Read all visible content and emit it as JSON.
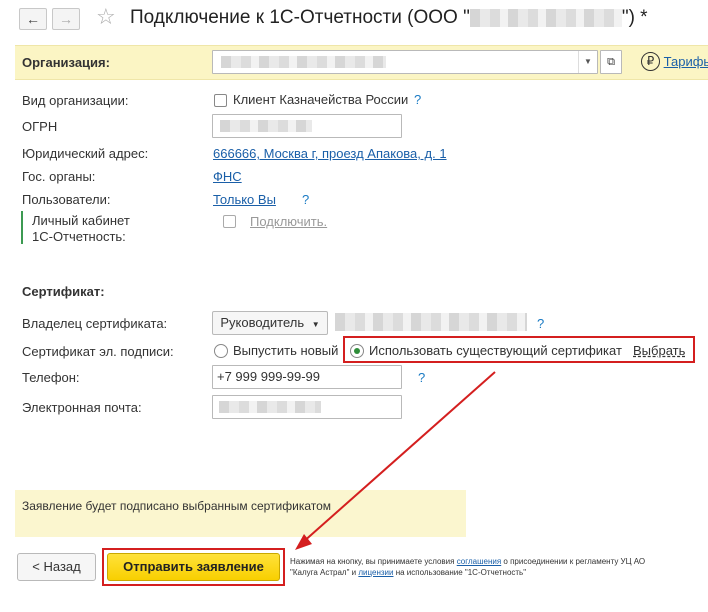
{
  "header": {
    "back_icon": "arrow-left-icon",
    "forward_icon": "arrow-right-icon",
    "star_icon": "star-icon",
    "title_prefix": "Подключение к 1С-Отчетности (ООО \"",
    "title_suffix": "\") *"
  },
  "org": {
    "label": "Организация:",
    "tariffs_label": "Тарифы"
  },
  "fields": {
    "org_type_label": "Вид организации:",
    "treasury_client_label": "Клиент Казначейства России",
    "ogrn_label": "ОГРН",
    "legal_address_label": "Юридический адрес:",
    "legal_address_value": "666666, Москва г, проезд Апакова, д. 1",
    "gov_label": "Гос. органы:",
    "gov_value": "ФНС",
    "users_label": "Пользователи:",
    "users_value": "Только Вы",
    "cabinet_label_line1": "Личный кабинет",
    "cabinet_label_line2": "1С-Отчетность:",
    "cabinet_connect": "Подключить."
  },
  "certificate": {
    "section_title": "Сертификат:",
    "owner_label": "Владелец сертификата:",
    "owner_value": "Руководитель",
    "cert_label": "Сертификат эл. подписи:",
    "option_new": "Выпустить новый",
    "option_existing": "Использовать существующий сертификат",
    "choose_link": "Выбрать",
    "selected_option": "existing",
    "phone_label": "Телефон:",
    "phone_value": "+7 999 999-99-99",
    "email_label": "Электронная почта:"
  },
  "info_text": "Заявление будет подписано выбранным сертификатом",
  "footer": {
    "back_button": "< Назад",
    "send_button": "Отправить заявление",
    "note_part1": "Нажимая на кнопку, вы принимаете условия ",
    "note_link1": "соглашения",
    "note_part2": " о присоединении к регламенту УЦ АО \"Калуга Астрал\" и ",
    "note_link2": "лицензии",
    "note_part3": " на использование \"1С-Отчетность\""
  },
  "help_mark": "?",
  "colors": {
    "highlight_red": "#d41f1f",
    "org_bar": "#fbf5c4",
    "primary_button": "#f8cf00",
    "link": "#1a5fa8",
    "radio_selected": "#2f8d3a"
  }
}
